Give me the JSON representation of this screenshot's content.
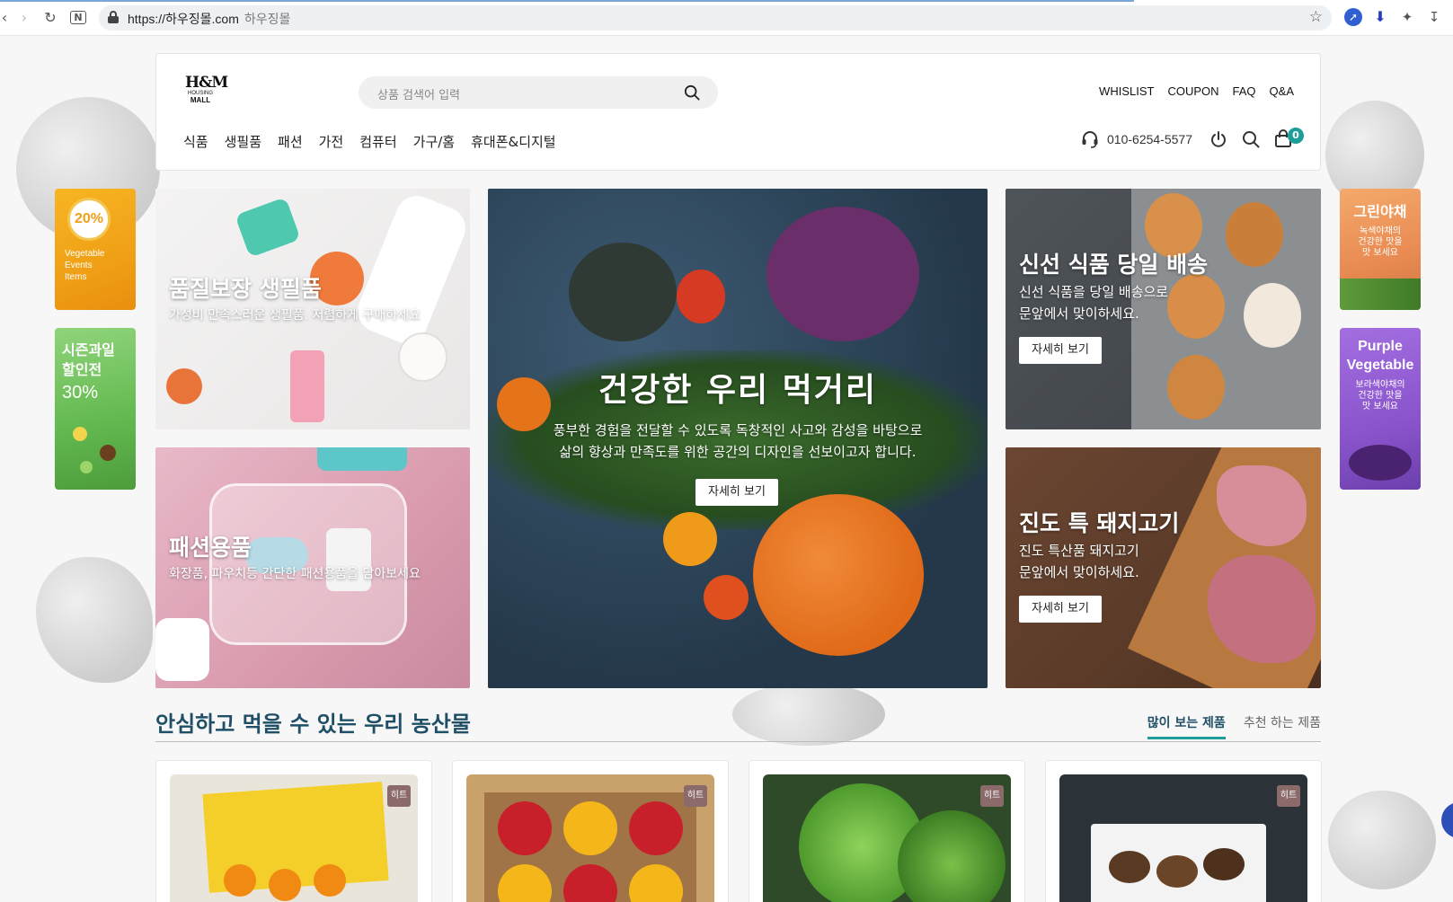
{
  "browser": {
    "url": "https://하우징몰.com",
    "page_title": "하우징몰"
  },
  "logo": {
    "mark": "H&M",
    "line1": "HOUSING",
    "line2": "MALL"
  },
  "search": {
    "placeholder": "상품 검색어 입력"
  },
  "top_links": [
    "WHISLIST",
    "COUPON",
    "FAQ",
    "Q&A"
  ],
  "menu": [
    "식품",
    "생필품",
    "패션",
    "가전",
    "컴퓨터",
    "가구/홈",
    "휴대폰&디지털"
  ],
  "contact": {
    "phone": "010-6254-5577"
  },
  "cart": {
    "count": "0"
  },
  "side_banners": {
    "left_top": {
      "percent": "20%",
      "line1": "Vegetable",
      "line2": "Events",
      "line3": "Items"
    },
    "left_bottom": {
      "line1": "시즌과일",
      "line2": "할인전",
      "line3": "30%"
    },
    "right_top": {
      "title": "그린야채",
      "line1": "녹색야채의",
      "line2": "건강한 맛을",
      "line3": "맛 보세요"
    },
    "right_bottom": {
      "title1": "Purple",
      "title2": "Vegetable",
      "line1": "보라색야채의",
      "line2": "건강한 맛을",
      "line3": "맛 보세요"
    }
  },
  "hero": {
    "daily": {
      "title": "품질보장 생필품",
      "desc": "가성비 만족스러운 생필품. 저렴하게 구매하세요"
    },
    "fashion": {
      "title": "패션용품",
      "desc": "화장품, 파우치등 간단한 패션용품을 담아보세요"
    },
    "main": {
      "title": "건강한 우리 먹거리",
      "desc1": "풍부한 경험을 전달할 수 있도록 독창적인 사고와 감성을 바탕으로",
      "desc2": "삶의 향상과 만족도를 위한 공간의 디자인을 선보이고자 합니다.",
      "button": "자세히 보기"
    },
    "egg": {
      "title": "신선 식품 당일 배송",
      "desc1": "신선 식품을 당일 배송으로",
      "desc2": "문앞에서 맞이하세요.",
      "button": "자세히 보기"
    },
    "pork": {
      "title": "진도 특 돼지고기",
      "desc1": "진도 특산품 돼지고기",
      "desc2": "문앞에서 맞이하세요.",
      "button": "자세히 보기"
    }
  },
  "section": {
    "title": "안심하고 먹을 수 있는 우리 농산물",
    "tabs": [
      "많이 보는 제품",
      "추천 하는 제품"
    ]
  },
  "products": [
    {
      "badge": "히트",
      "image": "citrus-gift-box"
    },
    {
      "badge": "히트",
      "image": "apple-pear-box"
    },
    {
      "badge": "히트",
      "image": "leafy-greens"
    },
    {
      "badge": "히트",
      "image": "shiitake-mushrooms"
    }
  ],
  "colors": {
    "accent": "#1e9e9a",
    "heading": "#1f4f66",
    "badge": "#8b6a6a"
  }
}
